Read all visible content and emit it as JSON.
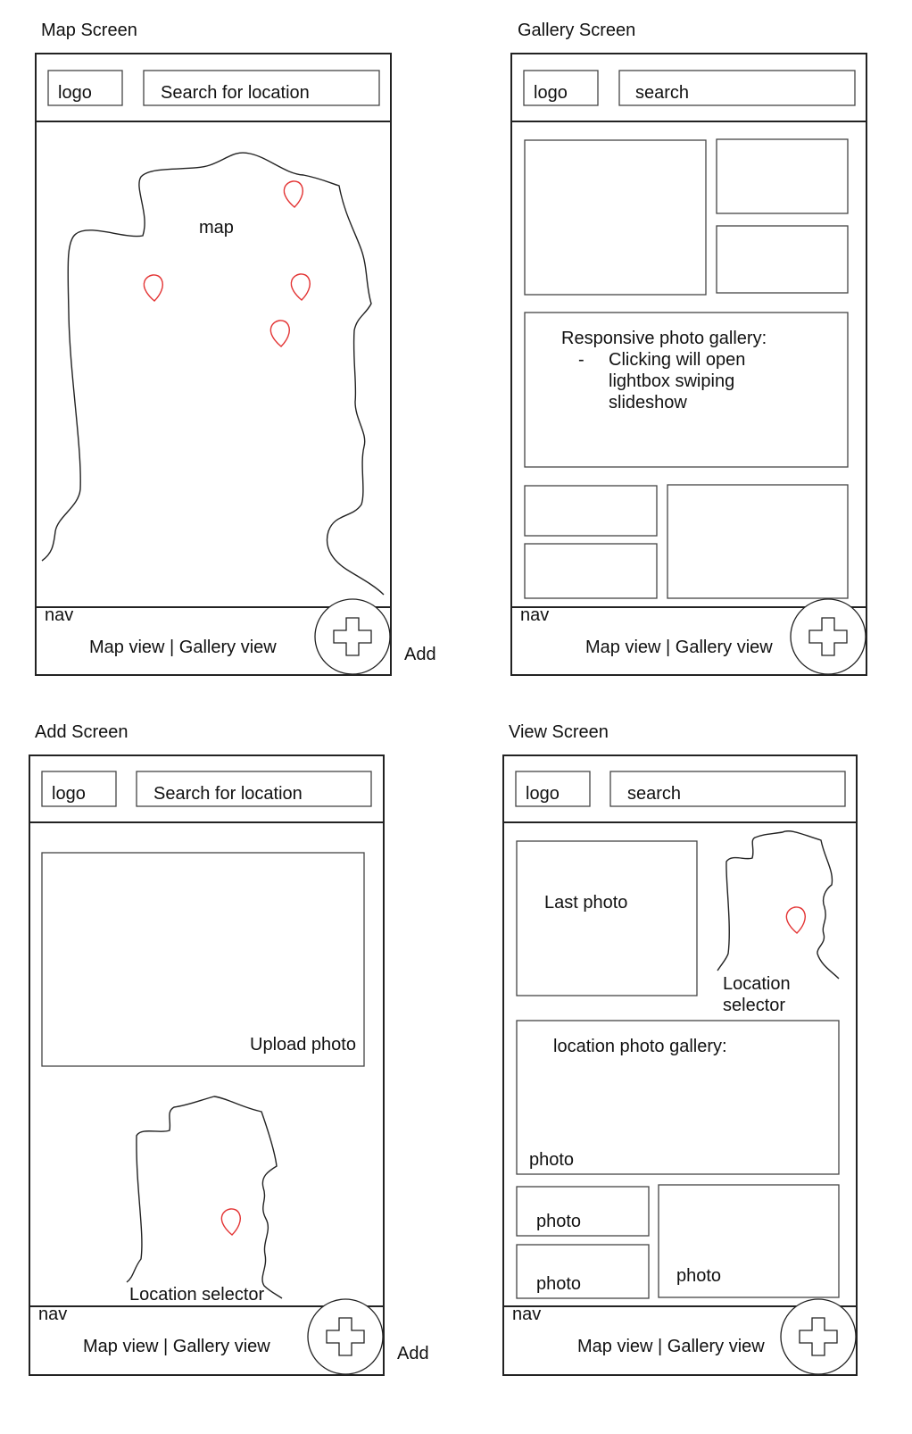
{
  "screens": {
    "map": {
      "title": "Map Screen",
      "logo": "logo",
      "search": "Search for location",
      "map_label": "map",
      "nav_label": "nav",
      "nav_links": "Map view | Gallery view",
      "add_label": "Add"
    },
    "gallery": {
      "title": "Gallery Screen",
      "logo": "logo",
      "search": "search",
      "note_title": "Responsive photo gallery:",
      "note_bullet": "-",
      "note_lines": [
        "Clicking will open",
        "lightbox swiping",
        "slideshow"
      ],
      "nav_label": "nav",
      "nav_links": "Map view | Gallery view"
    },
    "add": {
      "title": "Add Screen",
      "logo": "logo",
      "search": "Search for location",
      "upload_label": "Upload photo",
      "location_label": "Location selector",
      "nav_label": "nav",
      "nav_links": "Map view | Gallery view",
      "add_label": "Add"
    },
    "view": {
      "title": "View Screen",
      "logo": "logo",
      "search": "search",
      "last_photo": "Last photo",
      "location_lines": [
        "Location",
        "selector"
      ],
      "gallery_title": "location photo gallery:",
      "photo_labels": [
        "photo",
        "photo",
        "photo",
        "photo"
      ],
      "nav_label": "nav",
      "nav_links": "Map view | Gallery view"
    }
  },
  "colors": {
    "pin": "#e33333",
    "stroke": "#222222"
  },
  "icons": {
    "pin": "map-pin-icon",
    "add": "plus-icon"
  }
}
